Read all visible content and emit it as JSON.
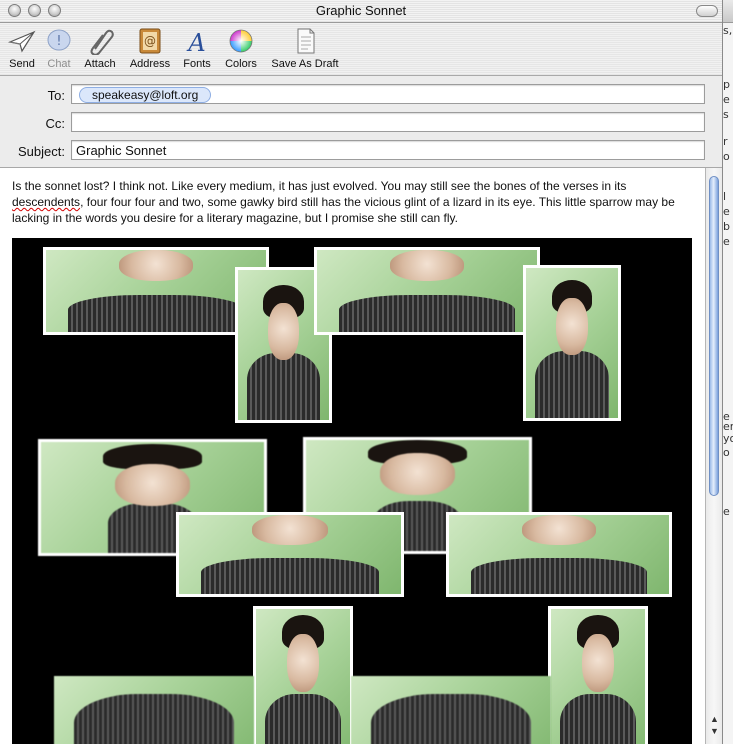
{
  "window": {
    "title": "Graphic Sonnet"
  },
  "toolbar": {
    "items": [
      {
        "label": "Send",
        "icon": "send-icon"
      },
      {
        "label": "Chat",
        "icon": "chat-icon",
        "disabled": true
      },
      {
        "label": "Attach",
        "icon": "paperclip-icon"
      },
      {
        "label": "Address",
        "icon": "address-book-icon"
      },
      {
        "label": "Fonts",
        "icon": "fonts-icon"
      },
      {
        "label": "Colors",
        "icon": "color-wheel-icon"
      },
      {
        "label": "Save As Draft",
        "icon": "draft-icon"
      }
    ]
  },
  "headers": {
    "to_label": "To:",
    "to_value": "speakeasy@loft.org",
    "cc_label": "Cc:",
    "cc_value": "",
    "subject_label": "Subject:",
    "subject_value": "Graphic Sonnet"
  },
  "message": {
    "text_before": "Is the sonnet lost?  I think not.  Like every medium, it has just evolved.  You may still see the bones of the verses in its ",
    "misspelled": "descendents",
    "text_after": ", four four four and two, some gawky bird still has the vicious glint of a lizard in its eye.  This little sparrow may be lacking in the words you desire for a literary magazine, but I promise she still can fly."
  },
  "background_window": {
    "fragments": [
      "s,",
      "p",
      "e",
      "s",
      "r",
      "o",
      "l",
      "e",
      "b",
      "e",
      "e",
      "ent",
      "yo",
      "o",
      "e"
    ]
  },
  "colors": {
    "collage_background": "#000000",
    "photo_backdrop": "#a9d39a",
    "token_fill": "#dbe7fb",
    "scroll_thumb": "#9cbbe8"
  }
}
